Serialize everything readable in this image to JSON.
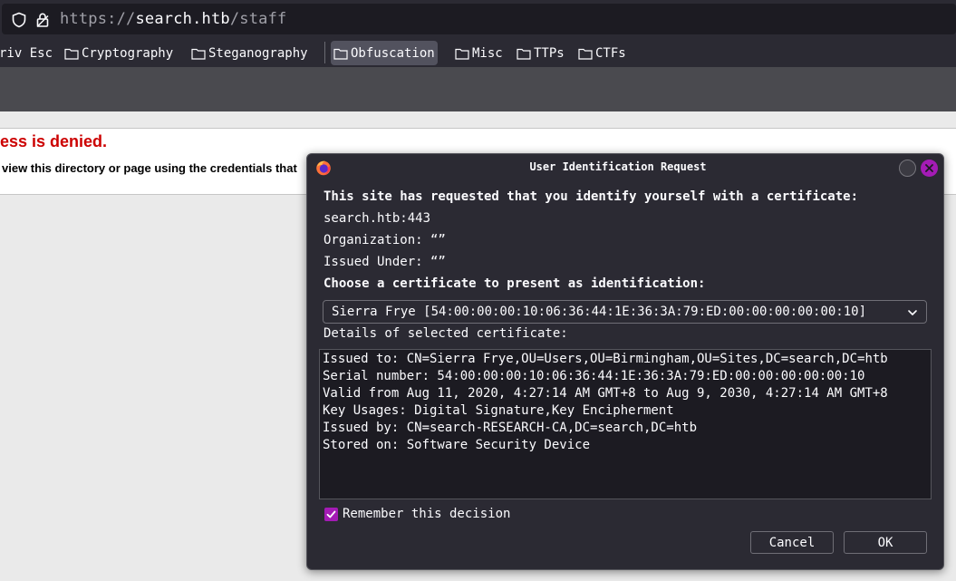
{
  "browser": {
    "url": {
      "scheme": "https://",
      "host": "search.htb",
      "path": "/staff"
    },
    "bookmarks": [
      {
        "label": "riv Esc",
        "has_icon": false
      },
      {
        "label": "Cryptography",
        "has_icon": true
      },
      {
        "label": "Steganography",
        "has_icon": true
      },
      {
        "label": "Obfuscation",
        "has_icon": true,
        "active": true
      },
      {
        "label": "Misc",
        "has_icon": true
      },
      {
        "label": "TTPs",
        "has_icon": true
      },
      {
        "label": "CTFs",
        "has_icon": true
      }
    ]
  },
  "page": {
    "heading": "ess is denied.",
    "message": "view this directory or page using the credentials that"
  },
  "dialog": {
    "title": "User Identification Request",
    "intro": "This site has requested that you identify yourself with a certificate:",
    "site": "search.htb:443",
    "organization": "Organization: “”",
    "issued_under": "Issued Under: “”",
    "choose_label": "Choose a certificate to present as identification:",
    "selected_certificate": "Sierra Frye [54:00:00:00:10:06:36:44:1E:36:3A:79:ED:00:00:00:00:00:10]",
    "details_label": "Details of selected certificate:",
    "details": [
      "Issued to: CN=Sierra Frye,OU=Users,OU=Birmingham,OU=Sites,DC=search,DC=htb",
      "Serial number: 54:00:00:00:10:06:36:44:1E:36:3A:79:ED:00:00:00:00:00:10",
      "Valid from Aug 11, 2020, 4:27:14 AM GMT+8 to Aug 9, 2030, 4:27:14 AM GMT+8",
      "Key Usages: Digital Signature,Key Encipherment",
      "Issued by: CN=search-RESEARCH-CA,DC=search,DC=htb",
      "Stored on: Software Security Device"
    ],
    "remember_label": "Remember this decision",
    "remember_checked": true,
    "cancel_label": "Cancel",
    "ok_label": "OK"
  },
  "colors": {
    "accent": "#a41bb5",
    "error": "#cc0000",
    "chrome_dark": "#2b2a33",
    "field_dark": "#1c1b22"
  },
  "icons": {
    "url_shield": "shield-icon",
    "url_lock": "lock-icon",
    "bookmark": "folder-icon",
    "dialog_app": "firefox-icon",
    "select": "chevron-down-icon",
    "dialog_close": "close-icon",
    "checkbox": "checkmark-icon"
  }
}
